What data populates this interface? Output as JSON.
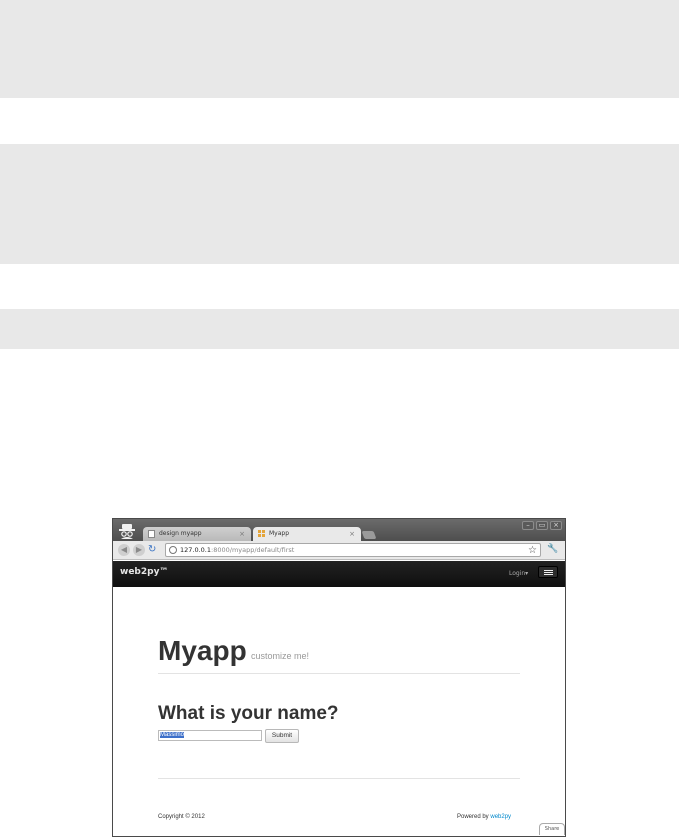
{
  "tabs": [
    {
      "label": "design myapp",
      "close": "×"
    },
    {
      "label": "Myapp",
      "close": "×"
    }
  ],
  "window_controls": {
    "minimize": "–",
    "maximize": "▭",
    "close": "×"
  },
  "address_bar": {
    "host": "127.0.0.1",
    "path": ":8000/myapp/default/first"
  },
  "navbar": {
    "brand": "web2py™",
    "login": "Login▾"
  },
  "page": {
    "title": "Myapp",
    "subtitle": "customize me!",
    "question": "What is your name?",
    "input_value": "Massimo",
    "submit_label": "Submit"
  },
  "footer": {
    "copyright": "Copyright © 2012",
    "powered_prefix": "Powered by ",
    "powered_link": "web2py"
  },
  "share_label": "Share",
  "colors": {
    "background_band": "#e8e8e8",
    "navbar": "#1a1a1a",
    "link": "#0088cc",
    "selection": "#3d6fc9"
  },
  "icons": [
    "incognito-icon",
    "page-icon",
    "web2py-favicon-icon",
    "back-icon",
    "forward-icon",
    "reload-icon",
    "globe-icon",
    "star-icon",
    "wrench-icon",
    "menu-icon"
  ]
}
